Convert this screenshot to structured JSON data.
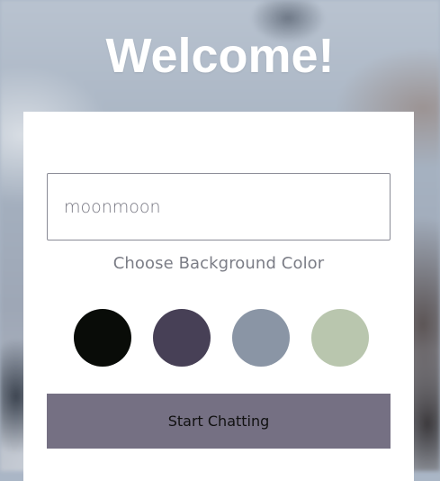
{
  "header": {
    "title": "Welcome!"
  },
  "form": {
    "name_value": "moonmoon",
    "color_label": "Choose Background Color",
    "colors": [
      "#090C08",
      "#474056",
      "#8A95A5",
      "#B9C6AE"
    ],
    "selected_color": "#757083",
    "submit_label": "Start Chatting"
  }
}
